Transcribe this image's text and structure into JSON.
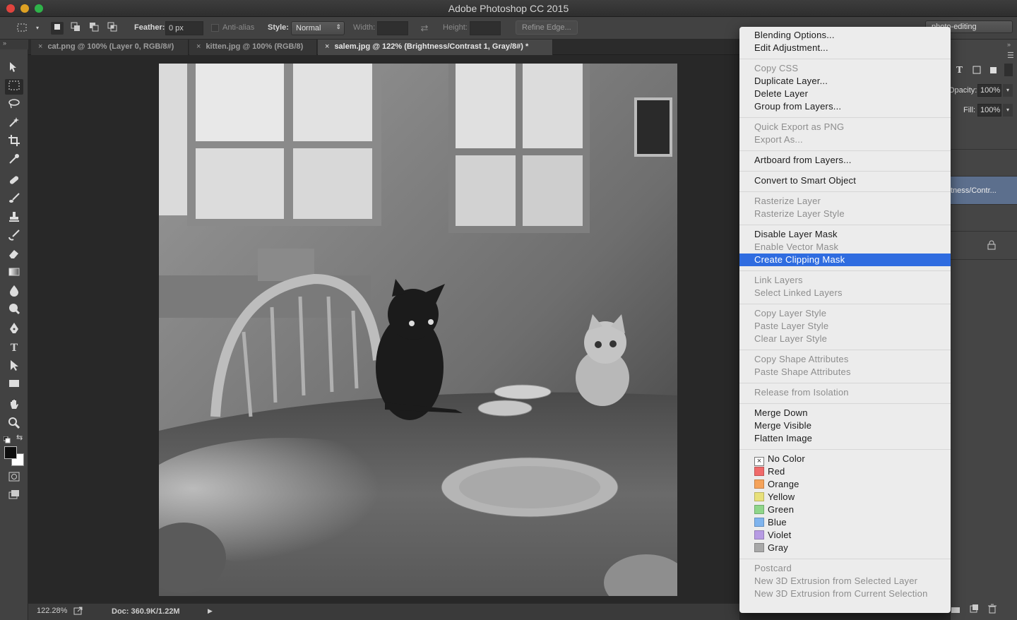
{
  "window": {
    "title": "Adobe Photoshop CC 2015"
  },
  "options_bar": {
    "feather_label": "Feather:",
    "feather_value": "0 px",
    "antialias_label": "Anti-alias",
    "style_label": "Style:",
    "style_value": "Normal",
    "width_label": "Width:",
    "height_label": "Height:",
    "refine_edge_label": "Refine Edge...",
    "workspace_value": "photo-editing"
  },
  "tabs": [
    {
      "label": "cat.png @ 100% (Layer 0, RGB/8#)",
      "active": false
    },
    {
      "label": "kitten.jpg @ 100% (RGB/8)",
      "active": false
    },
    {
      "label": "salem.jpg @ 122% (Brightness/Contrast 1, Gray/8#) *",
      "active": true
    }
  ],
  "status_bar": {
    "zoom": "122.28%",
    "doc_info": "Doc: 360.9K/1.22M"
  },
  "layers_panel": {
    "opacity_label": "Opacity:",
    "opacity_value": "100%",
    "fill_label": "Fill:",
    "fill_value": "100%",
    "selected_layer_label": "tness/Contr..."
  },
  "context_menu": {
    "groups": [
      [
        {
          "label": "Blending Options...",
          "enabled": true
        },
        {
          "label": "Edit Adjustment...",
          "enabled": true
        }
      ],
      [
        {
          "label": "Copy CSS",
          "enabled": false
        },
        {
          "label": "Duplicate Layer...",
          "enabled": true
        },
        {
          "label": "Delete Layer",
          "enabled": true
        },
        {
          "label": "Group from Layers...",
          "enabled": true
        }
      ],
      [
        {
          "label": "Quick Export as PNG",
          "enabled": false
        },
        {
          "label": "Export As...",
          "enabled": false
        }
      ],
      [
        {
          "label": "Artboard from Layers...",
          "enabled": true
        }
      ],
      [
        {
          "label": "Convert to Smart Object",
          "enabled": true
        }
      ],
      [
        {
          "label": "Rasterize Layer",
          "enabled": false
        },
        {
          "label": "Rasterize Layer Style",
          "enabled": false
        }
      ],
      [
        {
          "label": "Disable Layer Mask",
          "enabled": true
        },
        {
          "label": "Enable Vector Mask",
          "enabled": false
        },
        {
          "label": "Create Clipping Mask",
          "enabled": true,
          "highlighted": true
        }
      ],
      [
        {
          "label": "Link Layers",
          "enabled": false
        },
        {
          "label": "Select Linked Layers",
          "enabled": false
        }
      ],
      [
        {
          "label": "Copy Layer Style",
          "enabled": false
        },
        {
          "label": "Paste Layer Style",
          "enabled": false
        },
        {
          "label": "Clear Layer Style",
          "enabled": false
        }
      ],
      [
        {
          "label": "Copy Shape Attributes",
          "enabled": false
        },
        {
          "label": "Paste Shape Attributes",
          "enabled": false
        }
      ],
      [
        {
          "label": "Release from Isolation",
          "enabled": false
        }
      ],
      [
        {
          "label": "Merge Down",
          "enabled": true
        },
        {
          "label": "Merge Visible",
          "enabled": true
        },
        {
          "label": "Flatten Image",
          "enabled": true
        }
      ],
      [
        {
          "label": "No Color",
          "enabled": true,
          "color": "none"
        },
        {
          "label": "Red",
          "enabled": true,
          "color": "#f06a6a"
        },
        {
          "label": "Orange",
          "enabled": true,
          "color": "#f5a35a"
        },
        {
          "label": "Yellow",
          "enabled": true,
          "color": "#e8e07a"
        },
        {
          "label": "Green",
          "enabled": true,
          "color": "#8fd68a"
        },
        {
          "label": "Blue",
          "enabled": true,
          "color": "#7fb4ee"
        },
        {
          "label": "Violet",
          "enabled": true,
          "color": "#b79be3"
        },
        {
          "label": "Gray",
          "enabled": true,
          "color": "#a8a8a8"
        }
      ],
      [
        {
          "label": "Postcard",
          "enabled": false
        },
        {
          "label": "New 3D Extrusion from Selected Layer",
          "enabled": false
        },
        {
          "label": "New 3D Extrusion from Current Selection",
          "enabled": false
        }
      ]
    ]
  },
  "tools": [
    "move-tool-icon",
    "marquee-tool-icon",
    "lasso-tool-icon",
    "magic-wand-icon",
    "crop-tool-icon",
    "eyedropper-icon",
    "healing-brush-icon",
    "brush-tool-icon",
    "clone-stamp-icon",
    "history-brush-icon",
    "eraser-icon",
    "gradient-tool-icon",
    "blur-tool-icon",
    "dodge-tool-icon",
    "pen-tool-icon",
    "type-tool-icon",
    "path-select-icon",
    "rectangle-tool-icon",
    "hand-tool-icon",
    "zoom-tool-icon"
  ],
  "colors": {
    "menu_highlight": "#2f6ce0",
    "chrome_dark": "#424242",
    "canvas_bg": "#282828"
  }
}
